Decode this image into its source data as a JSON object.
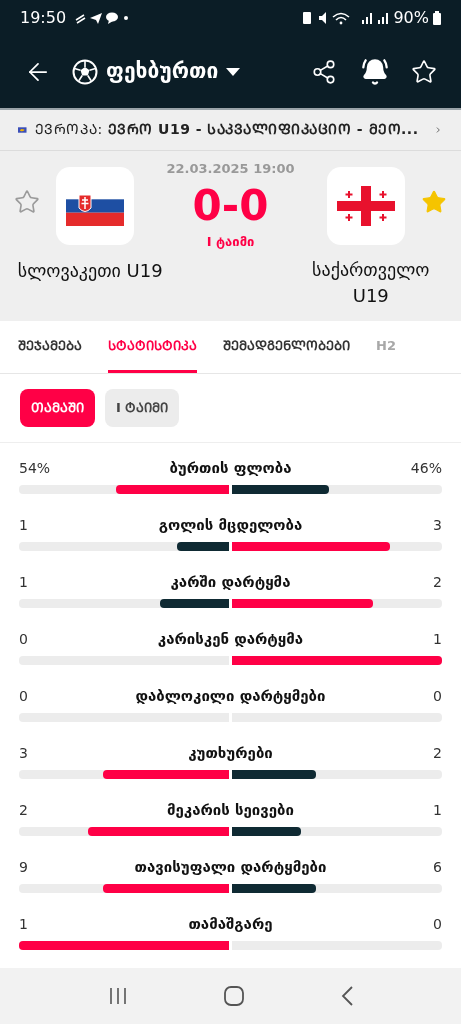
{
  "status_bar": {
    "time": "19:50",
    "battery": "90%"
  },
  "header": {
    "title": "ფეხბურთი",
    "alerts_on": true,
    "favorite": false
  },
  "competition": {
    "text": "ᲔᲕᲠᲝᲞᲐ: **ᲔᲕᲠᲝ U19 - ᲡᲐᲙᲕᲐᲚᲘᲤᲘᲙᲐᲪᲘᲝ - ᲛᲔᲝ...**"
  },
  "match": {
    "datetime": "22.03.2025 19:00",
    "score": "0-0",
    "period": "I ტაიმი",
    "home": {
      "name": "სლოვაკეთი U19",
      "favorite": false
    },
    "away": {
      "name": "საქართველო U19",
      "favorite": true
    }
  },
  "tabs": [
    {
      "label": "ᲨᲔᲯᲐᲛᲔᲑᲐ",
      "selected": false
    },
    {
      "label": "ᲡᲢᲐᲢᲘᲡᲢᲘᲙᲐ",
      "selected": true
    },
    {
      "label": "ᲨᲔᲛᲐᲓᲒᲔᲜᲚᲝᲑᲔᲑᲘ",
      "selected": false
    },
    {
      "label": "H2",
      "selected": false,
      "faded": true
    }
  ],
  "filters": [
    {
      "label": "ᲗᲐᲛᲐᲨᲘ",
      "selected": true
    },
    {
      "label": "I ᲢᲐᲘᲛᲘ",
      "selected": false
    }
  ],
  "stats": [
    {
      "label": "ბურთის ფლობა",
      "home": {
        "value": "54%",
        "level": 0.54,
        "highlighted": true
      },
      "away": {
        "value": "46%",
        "level": 0.46,
        "highlighted": false
      }
    },
    {
      "label": "გოლის მცდელობა",
      "home": {
        "value": "1",
        "level": 0.25,
        "highlighted": false
      },
      "away": {
        "value": "3",
        "level": 0.75,
        "highlighted": true
      }
    },
    {
      "label": "კარში დარტყმა",
      "home": {
        "value": "1",
        "level": 0.33,
        "highlighted": false
      },
      "away": {
        "value": "2",
        "level": 0.67,
        "highlighted": true
      }
    },
    {
      "label": "კარისკენ დარტყმა",
      "home": {
        "value": "0",
        "level": 0
      },
      "away": {
        "value": "1",
        "level": 1,
        "highlighted": true
      }
    },
    {
      "label": "დაბლოკილი დარტყმები",
      "home": {
        "value": "0",
        "level": 0
      },
      "away": {
        "value": "0",
        "level": 0
      }
    },
    {
      "label": "კუთხურები",
      "home": {
        "value": "3",
        "level": 0.6,
        "highlighted": true
      },
      "away": {
        "value": "2",
        "level": 0.4,
        "highlighted": false
      }
    },
    {
      "label": "მეკარის სეივები",
      "home": {
        "value": "2",
        "level": 0.67,
        "highlighted": true
      },
      "away": {
        "value": "1",
        "level": 0.33,
        "highlighted": false
      }
    },
    {
      "label": "თავისუფალი დარტყმები",
      "home": {
        "value": "9",
        "level": 0.6,
        "highlighted": true
      },
      "away": {
        "value": "6",
        "level": 0.4,
        "highlighted": false
      }
    },
    {
      "label": "თამაშგარე",
      "home": {
        "value": "1",
        "level": 1,
        "highlighted": true
      },
      "away": {
        "value": "0",
        "level": 0
      }
    }
  ]
}
